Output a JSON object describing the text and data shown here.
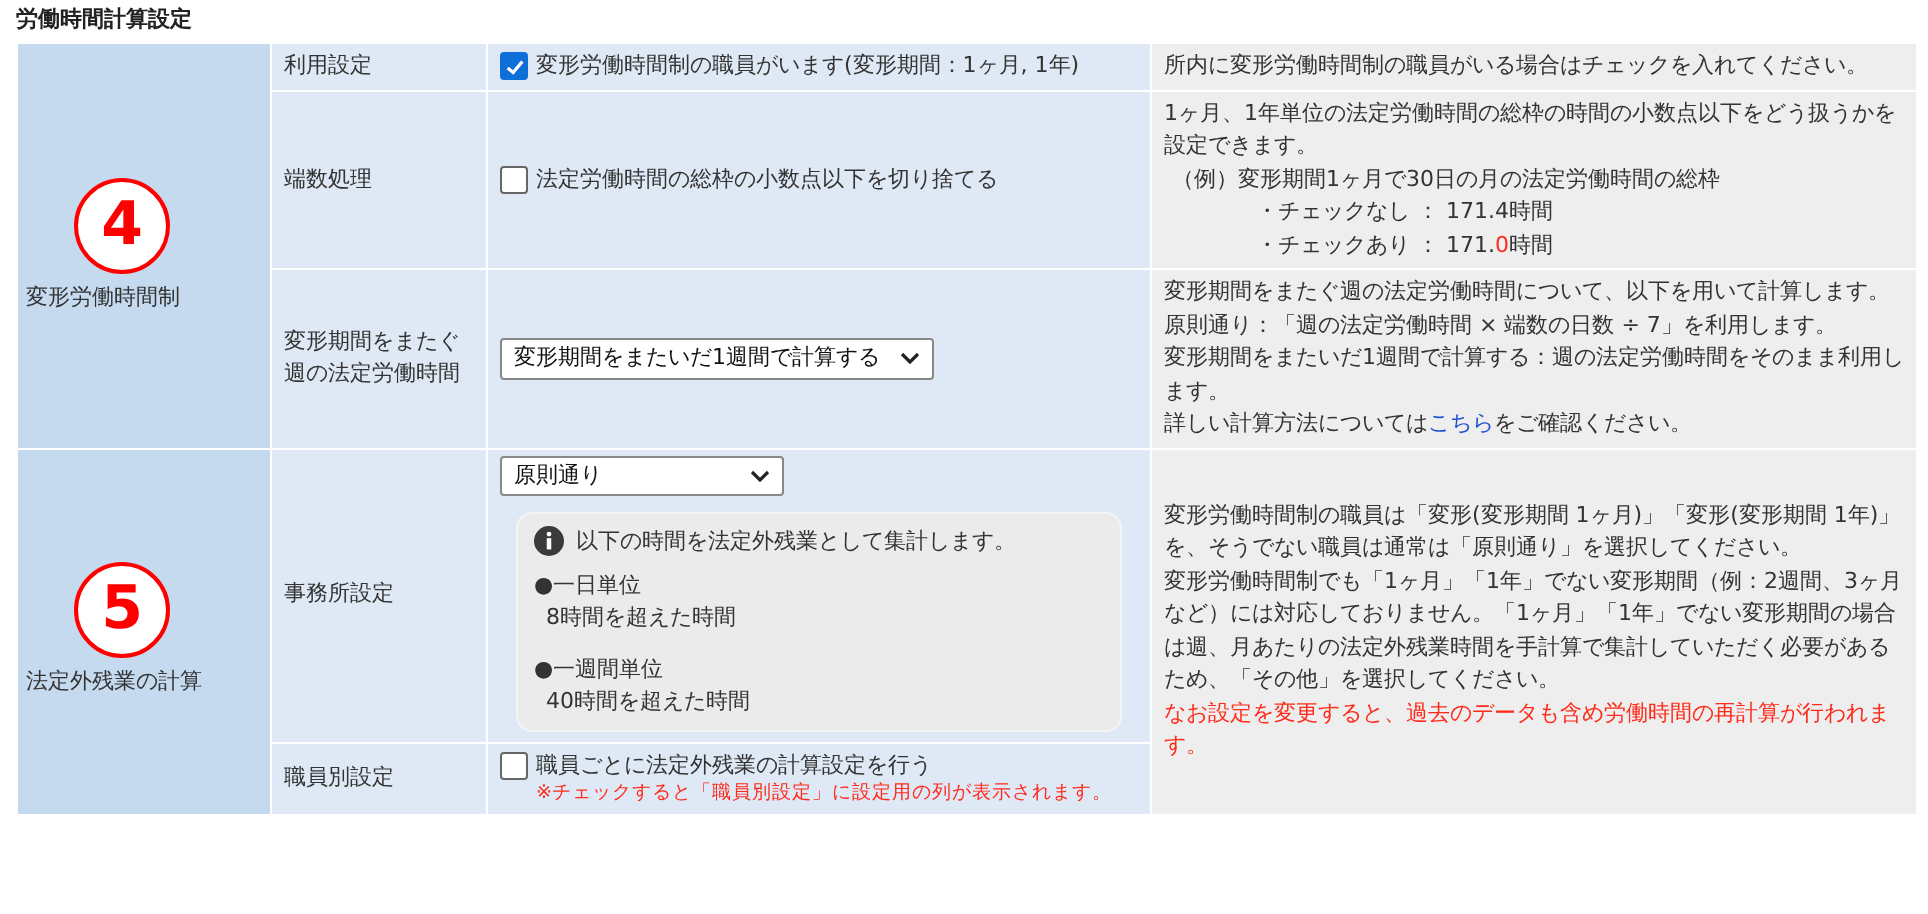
{
  "title": "労働時間計算設定",
  "sections": [
    {
      "badge": "4",
      "name": "変形労働時間制",
      "rows": [
        {
          "label": "利用設定",
          "control": {
            "kind": "checkbox",
            "label": "変形労働時間制の職員がいます(変形期間：1ヶ月, 1年)",
            "checked": true
          },
          "description": [
            {
              "kind": "text",
              "segments": [
                {
                  "text": "所内に変形労働時間制の職員がいる場合はチェックを入れてください。"
                }
              ]
            }
          ]
        },
        {
          "label": "端数処理",
          "control": {
            "kind": "checkbox",
            "label": "法定労働時間の総枠の小数点以下を切り捨てる",
            "checked": false
          },
          "description": [
            {
              "kind": "text",
              "segments": [
                {
                  "text": "1ヶ月、1年単位の法定労働時間の総枠の時間の小数点以下をどう扱うかを設定できます。"
                }
              ]
            },
            {
              "kind": "example",
              "segments": [
                {
                  "text": "（例）変形期間1ヶ月で30日の月の法定労働時間の総枠"
                }
              ]
            },
            {
              "kind": "example-item",
              "segments": [
                {
                  "text": "・チェックなし ： 171.4時間"
                }
              ]
            },
            {
              "kind": "example-item",
              "segments": [
                {
                  "text": "・チェックあり ： 171."
                },
                {
                  "text": "0",
                  "kind": "alert"
                },
                {
                  "text": "時間"
                }
              ]
            }
          ]
        },
        {
          "label": "変形期間をまたぐ週の法定労働時間",
          "control": {
            "kind": "select",
            "value": "変形期間をまたいだ1週間で計算する"
          },
          "description": [
            {
              "kind": "text",
              "segments": [
                {
                  "text": "変形期間をまたぐ週の法定労働時間について、以下を用いて計算します。"
                }
              ]
            },
            {
              "kind": "text",
              "segments": [
                {
                  "text": "原則通り：「週の法定労働時間 × 端数の日数 ÷ 7」を利用します。"
                }
              ]
            },
            {
              "kind": "text",
              "segments": [
                {
                  "text": "変形期間をまたいだ1週間で計算する：週の法定労働時間をそのまま利用します。"
                }
              ]
            },
            {
              "kind": "text",
              "segments": [
                {
                  "text": "詳しい計算方法については"
                },
                {
                  "text": "こちら",
                  "kind": "link"
                },
                {
                  "text": "をご確認ください。"
                }
              ]
            }
          ]
        }
      ]
    },
    {
      "badge": "5",
      "name": "法定外残業の計算",
      "description": [
        {
          "kind": "text",
          "segments": [
            {
              "text": "変形労働時間制の職員は「変形(変形期間 1ヶ月)」「変形(変形期間 1年)」を、そうでない職員は通常は「原則通り」を選択してください。"
            }
          ]
        },
        {
          "kind": "text",
          "segments": [
            {
              "text": "変形労働時間制でも「1ヶ月」「1年」でない変形期間（例：2週間、3ヶ月など）には対応しておりません。「1ヶ月」「1年」でない変形期間の場合は週、月あたりの法定外残業時間を手計算で集計していただく必要があるため、「その他」を選択してください。"
            }
          ]
        },
        {
          "kind": "text",
          "segments": [
            {
              "text": "なお設定を変更すると、過去のデータも含め労働時間の再計算が行われます。",
              "kind": "alert"
            }
          ]
        }
      ],
      "rows": [
        {
          "label": "事務所設定",
          "control": {
            "kind": "select",
            "value": "原則通り",
            "info": {
              "heading": "以下の時間を法定外残業として集計します。",
              "items": [
                {
                  "title": "●一日単位",
                  "detail": "8時間を超えた時間"
                },
                {
                  "title": "●一週間単位",
                  "detail": "40時間を超えた時間"
                }
              ]
            }
          }
        },
        {
          "label": "職員別設定",
          "control": {
            "kind": "checkbox",
            "label": "職員ごとに法定外残業の計算設定を行う",
            "checked": false,
            "note": "※チェックすると「職員別設定」に設定用の列が表示されます。"
          }
        }
      ]
    }
  ]
}
